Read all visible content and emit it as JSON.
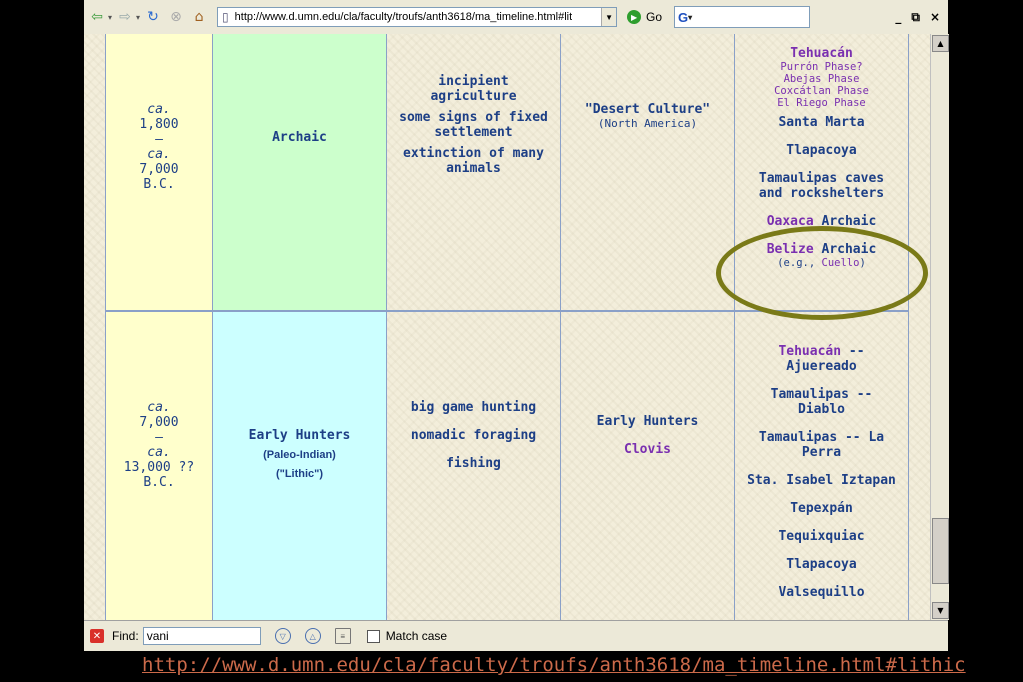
{
  "browser": {
    "url": "http://www.d.umn.edu/cla/faculty/troufs/anth3618/ma_timeline.html#lit",
    "go_label": "Go",
    "search_logo": "G",
    "window_controls": [
      "_",
      "ɑ",
      "×"
    ]
  },
  "findbar": {
    "label": "Find:",
    "value": "vani",
    "match_case_label": "Match case"
  },
  "table": {
    "row_archaic": {
      "date": [
        "ca.",
        "1,800",
        "–",
        "ca.",
        "7,000",
        "B.C."
      ],
      "stage": "Archaic",
      "traits": [
        "incipient agriculture",
        "some signs of fixed settlement",
        "extinction of many animals"
      ],
      "north_america_title": "\"Desert Culture\"",
      "north_america_sub": "(North America)",
      "sites": {
        "tehuacan": "Tehuacán",
        "tehuacan_phases": [
          "Purrón Phase?",
          "Abejas Phase",
          "Coxcátlan Phase",
          "El Riego Phase"
        ],
        "santa_marta": "Santa Marta",
        "tlapacoya": "Tlapacoya",
        "tamaulipas": "Tamaulipas caves and rockshelters",
        "oaxaca": "Oaxaca",
        "oaxaca_suffix": "Archaic",
        "belize": "Belize",
        "belize_suffix": "Archaic",
        "belize_eg_prefix": "(e.g.,",
        "belize_eg_link": "Cuello",
        "belize_eg_suffix": ")"
      }
    },
    "row_hunters": {
      "date": [
        "ca.",
        "7,000",
        "–",
        "ca.",
        "13,000 ??",
        "B.C."
      ],
      "stage": "Early Hunters",
      "stage_sub1": "(Paleo-Indian)",
      "stage_sub2": "(\"Lithic\")",
      "traits": [
        "big game hunting",
        "nomadic foraging",
        "fishing"
      ],
      "north_america_title": "Early Hunters",
      "north_america_link": "Clovis",
      "sites": {
        "tehuacan": "Tehuacán",
        "tehuacan_suffix": "-- Ajuereado",
        "tamaulipas_diablo": "Tamaulipas -- Diablo",
        "tamaulipas_laperra": "Tamaulipas -- La Perra",
        "sta_isabel": "Sta. Isabel Iztapan",
        "tepexpan": "Tepexpán",
        "tequixquiac": "Tequixquiac",
        "tlapacoya": "Tlapacoya",
        "valsequillo": "Valsequillo"
      }
    }
  },
  "caption_url": "http://www.d.umn.edu/cla/faculty/troufs/anth3618/ma_timeline.html#lithic",
  "colors": {
    "date_cell": "#ffffcc",
    "archaic_cell": "#ccffcc",
    "hunters_cell": "#ccffff",
    "text_blue": "#1d3f86",
    "link_purple": "#7a2fb0",
    "highlight_oval": "#7a7a18",
    "caption": "#cc6a4a"
  }
}
